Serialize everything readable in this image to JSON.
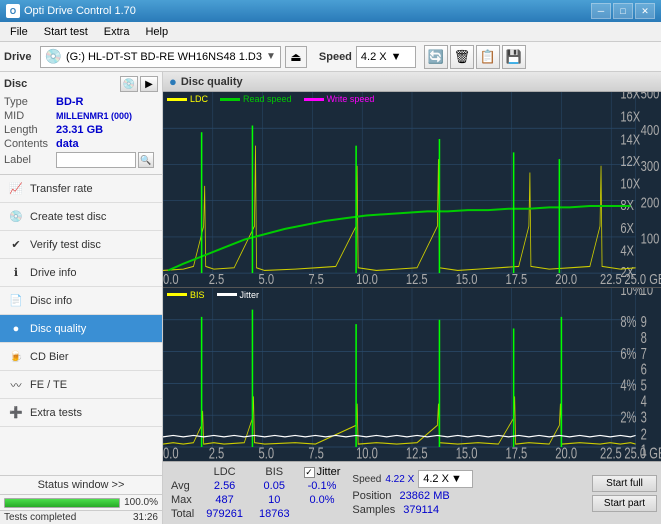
{
  "titlebar": {
    "title": "Opti Drive Control 1.70",
    "icon_text": "O",
    "minimize": "─",
    "maximize": "□",
    "close": "✕"
  },
  "menubar": {
    "items": [
      "File",
      "Start test",
      "Extra",
      "Help"
    ]
  },
  "drivebar": {
    "drive_label": "Drive",
    "drive_text": "(G:)  HL-DT-ST BD-RE  WH16NS48 1.D3",
    "speed_label": "Speed",
    "speed_value": "4.2 X"
  },
  "disc": {
    "title": "Disc",
    "type_label": "Type",
    "type_value": "BD-R",
    "mid_label": "MID",
    "mid_value": "MILLENMR1 (000)",
    "length_label": "Length",
    "length_value": "23.31 GB",
    "contents_label": "Contents",
    "contents_value": "data",
    "label_label": "Label",
    "label_value": ""
  },
  "sidebar_items": [
    {
      "id": "transfer-rate",
      "label": "Transfer rate",
      "icon": "📈",
      "active": false
    },
    {
      "id": "create-test-disc",
      "label": "Create test disc",
      "icon": "💿",
      "active": false
    },
    {
      "id": "verify-test-disc",
      "label": "Verify test disc",
      "icon": "✔",
      "active": false
    },
    {
      "id": "drive-info",
      "label": "Drive info",
      "icon": "ℹ",
      "active": false
    },
    {
      "id": "disc-info",
      "label": "Disc info",
      "icon": "📄",
      "active": false
    },
    {
      "id": "disc-quality",
      "label": "Disc quality",
      "icon": "🔵",
      "active": true
    },
    {
      "id": "cd-bier",
      "label": "CD Bier",
      "icon": "🍺",
      "active": false
    },
    {
      "id": "fe-te",
      "label": "FE / TE",
      "icon": "〰",
      "active": false
    },
    {
      "id": "extra-tests",
      "label": "Extra tests",
      "icon": "➕",
      "active": false
    }
  ],
  "chart": {
    "title": "Disc quality",
    "legend": [
      {
        "label": "LDC",
        "color": "#ffff00"
      },
      {
        "label": "Read speed",
        "color": "#00cc00"
      },
      {
        "label": "Write speed",
        "color": "#ff00ff"
      }
    ],
    "legend2": [
      {
        "label": "BIS",
        "color": "#ffff00"
      },
      {
        "label": "Jitter",
        "color": "#ffffff"
      }
    ],
    "x_max": "25.0",
    "y_max_upper": "500",
    "y_max_lower": "10",
    "right_labels_upper": [
      "18X",
      "16X",
      "14X",
      "12X",
      "10X",
      "8X",
      "6X",
      "4X",
      "2X"
    ],
    "right_labels_lower": [
      "10%",
      "8%",
      "6%",
      "4%",
      "2%"
    ]
  },
  "stats": {
    "ldc_label": "LDC",
    "bis_label": "BIS",
    "jitter_label": "Jitter",
    "speed_label": "Speed",
    "speed_value": "4.22 X",
    "speed_dropdown": "4.2 X",
    "avg_label": "Avg",
    "avg_ldc": "2.56",
    "avg_bis": "0.05",
    "avg_jitter": "-0.1%",
    "max_label": "Max",
    "max_ldc": "487",
    "max_bis": "10",
    "max_jitter": "0.0%",
    "total_label": "Total",
    "total_ldc": "979261",
    "total_bis": "18763",
    "position_label": "Position",
    "position_value": "23862 MB",
    "samples_label": "Samples",
    "samples_value": "379114",
    "start_full": "Start full",
    "start_part": "Start part",
    "jitter_checked": true
  },
  "status": {
    "text": "Tests completed",
    "progress": 100,
    "progress_text": "100.0%",
    "time": "31:26"
  }
}
